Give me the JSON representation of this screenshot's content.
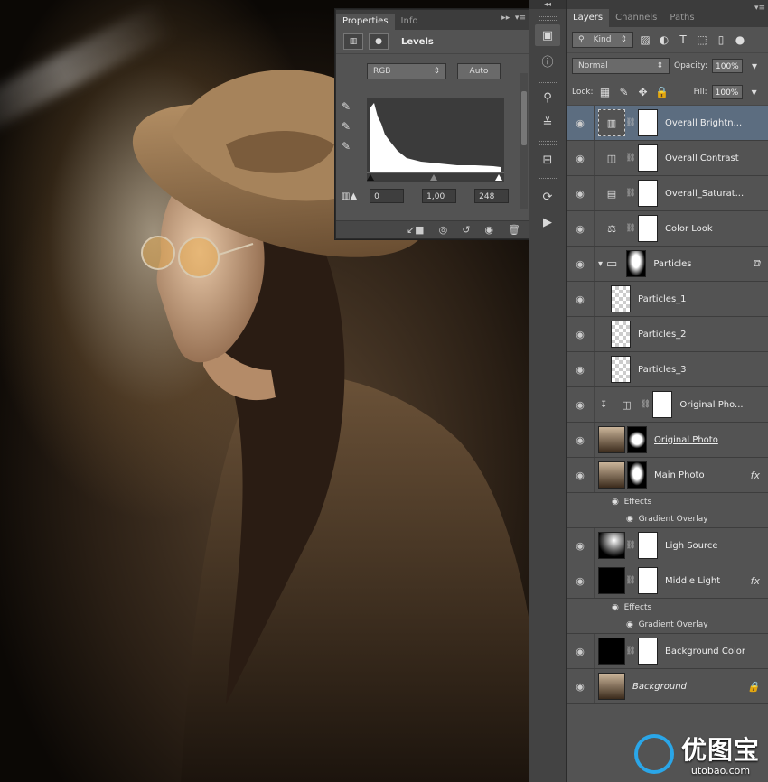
{
  "properties_panel": {
    "tabs": [
      "Properties",
      "Info"
    ],
    "title": "Levels",
    "channel": "RGB",
    "auto_label": "Auto",
    "input_black": "0",
    "input_gamma": "1,00",
    "input_white": "248"
  },
  "layers_panel": {
    "tabs": [
      "Layers",
      "Channels",
      "Paths"
    ],
    "filter_kind": "Kind",
    "blend_mode": "Normal",
    "opacity_label": "Opacity:",
    "opacity_value": "100%",
    "lock_label": "Lock:",
    "fill_label": "Fill:",
    "fill_value": "100%",
    "layers": [
      {
        "name": "Overall Brightn..."
      },
      {
        "name": "Overall Contrast"
      },
      {
        "name": "Overall_Saturat..."
      },
      {
        "name": "Color Look"
      },
      {
        "name": "Particles"
      },
      {
        "name": "Particles_1"
      },
      {
        "name": "Particles_2"
      },
      {
        "name": "Particles_3"
      },
      {
        "name": "Original Pho..."
      },
      {
        "name": "Original Photo"
      },
      {
        "name": "Main Photo"
      },
      {
        "name": "Ligh Source"
      },
      {
        "name": "Middle Light"
      },
      {
        "name": "Background Color"
      },
      {
        "name": "Background"
      }
    ],
    "effects_label": "Effects",
    "gradient_overlay_label": "Gradient Overlay"
  },
  "watermark": {
    "cn": "优图宝",
    "url": "utobao.com"
  },
  "colors": {
    "selected_row": "#5c6d80",
    "panel_bg": "#535353",
    "brand_blue": "#2aa6e8"
  }
}
